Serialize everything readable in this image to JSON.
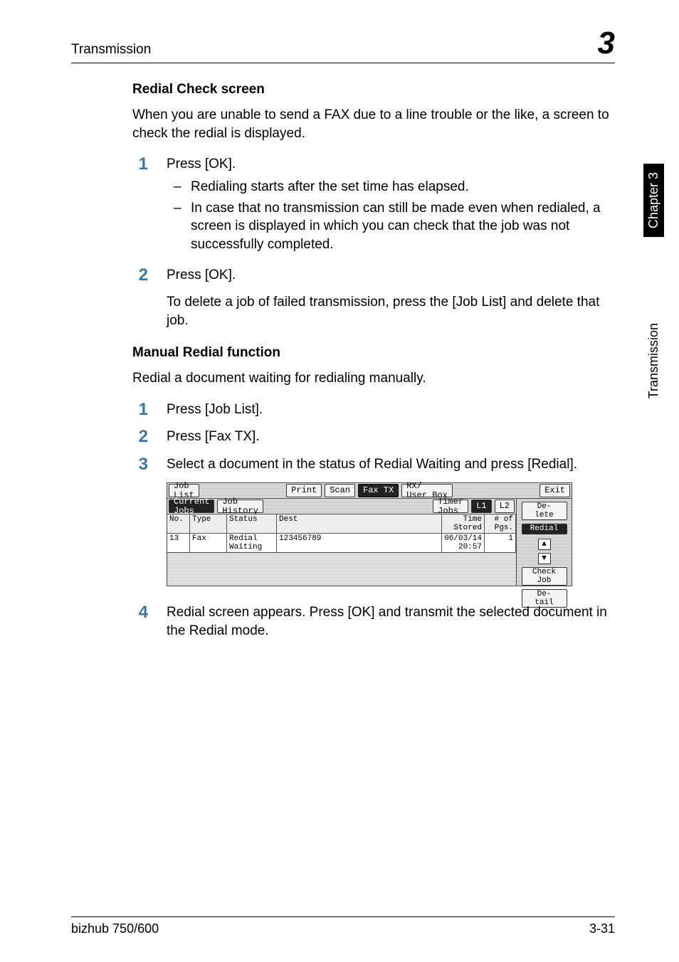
{
  "header": {
    "left": "Transmission",
    "right": "3"
  },
  "sideTab": {
    "chapter": "Chapter 3",
    "section": "Transmission"
  },
  "sections": {
    "redial": {
      "heading": "Redial Check screen",
      "intro": "When you are unable to send a FAX due to a line trouble or the like, a screen to check the redial is displayed.",
      "step1": "Press [OK].",
      "bullets": [
        "Redialing starts after the set time has elapsed.",
        "In case that no transmission can still be made even when redialed, a screen is displayed in which you can check that the job was not successfully completed."
      ],
      "step2a": "Press [OK].",
      "step2b": "To delete a job of failed transmission, press the [Job List] and delete that job."
    },
    "manual": {
      "heading": "Manual Redial function",
      "intro": "Redial a document waiting for redialing manually.",
      "step1": "Press [Job List].",
      "step2": "Press [Fax TX].",
      "step3": "Select a document in the status of Redial Waiting and press [Redial].",
      "step4": "Redial screen appears. Press [OK] and transmit the selected document in the Redial mode."
    }
  },
  "ui": {
    "topbar": {
      "jobList": "Job\nList",
      "print": "Print",
      "scan": "Scan",
      "faxTx": "Fax TX",
      "userBox": "RX/\nUser Box",
      "exit": "Exit"
    },
    "tabbar": {
      "currentJobs": "Current\nJobs",
      "jobHistory": "Job\nHistory",
      "timerJobs": "Timer\nJobs",
      "l1": "L1",
      "l2": "L2"
    },
    "cols": {
      "no": "No.",
      "type": "Type",
      "status": "Status",
      "dest": "Dest",
      "time": "Time\nStored",
      "pgs": "# of\nPgs."
    },
    "row": {
      "no": "13",
      "type": "Fax",
      "status": "Redial\nWaiting",
      "dest": "123456789",
      "time": "06/03/14\n20:57",
      "pgs": "1"
    },
    "right": {
      "delete": "De-\nlete",
      "redial": "Redial",
      "upIcon": "up-arrow-icon",
      "downIcon": "down-arrow-icon",
      "checkJob": "Check\nJob",
      "detail": "De-\ntail"
    }
  },
  "footer": {
    "left": "bizhub 750/600",
    "right": "3-31"
  }
}
